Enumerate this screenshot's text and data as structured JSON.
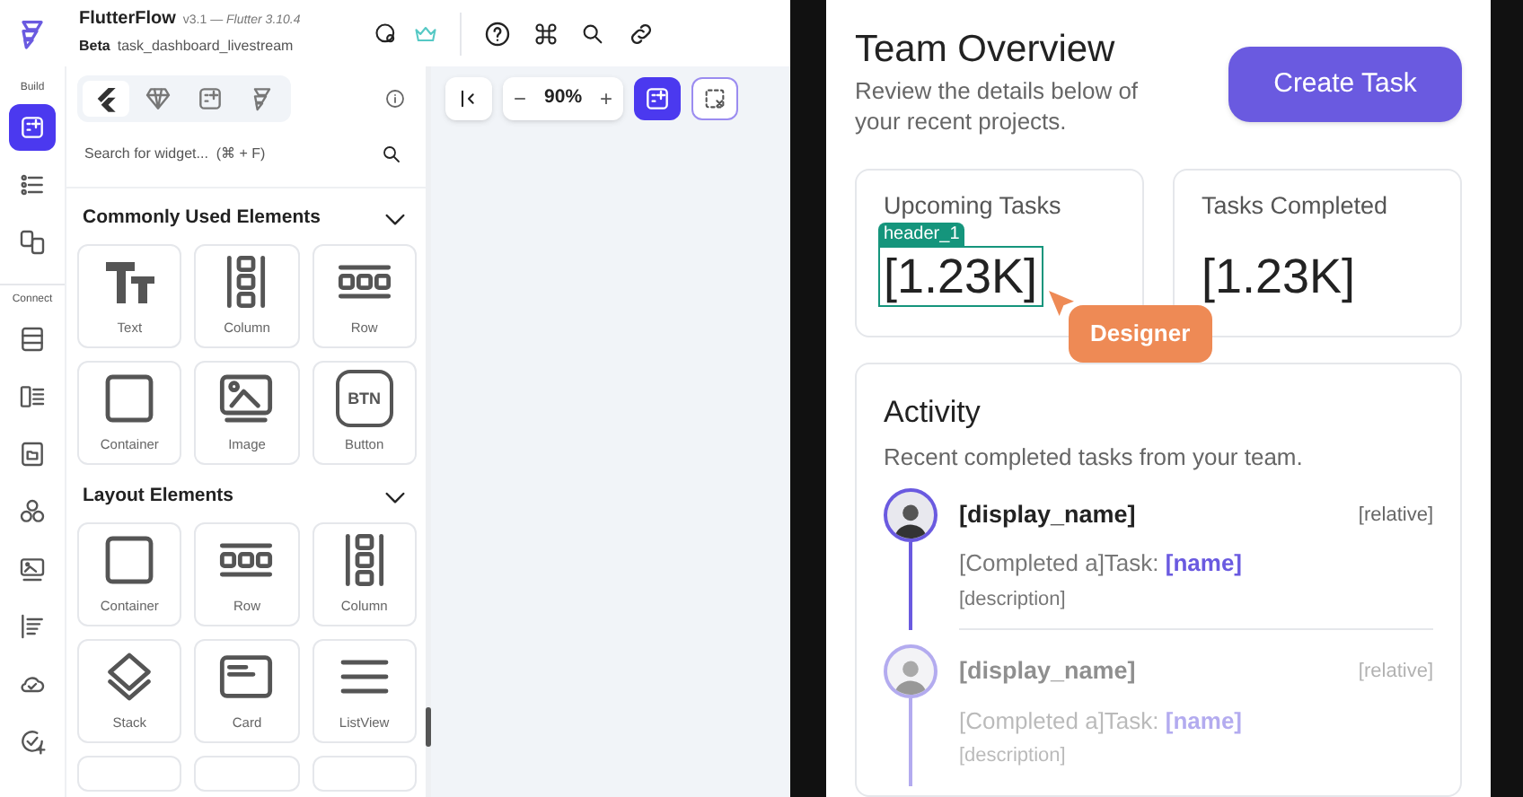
{
  "app": {
    "name": "FlutterFlow",
    "version": "v3.1 — ",
    "flutter_version": "Flutter 3.10.4",
    "channel": "Beta",
    "project": "task_dashboard_livestream"
  },
  "rail": {
    "sections": [
      {
        "label": "Build",
        "items": [
          {
            "selected": true
          },
          {
            "selected": false
          },
          {
            "selected": false
          }
        ]
      },
      {
        "label": "Connect",
        "items": [
          {
            "selected": false
          },
          {
            "selected": false
          },
          {
            "selected": false
          },
          {
            "selected": false
          },
          {
            "selected": false
          },
          {
            "selected": false
          },
          {
            "selected": false
          },
          {
            "selected": false
          }
        ]
      }
    ]
  },
  "panel": {
    "tabs": [
      {
        "selected": true
      },
      {
        "selected": false
      },
      {
        "selected": false
      },
      {
        "selected": false
      }
    ],
    "search": {
      "placeholder": "Search for widget...  (⌘ + F)"
    },
    "groups": [
      {
        "title": "Commonly Used Elements",
        "expanded": true,
        "items": [
          {
            "kind": "text",
            "label": "Text"
          },
          {
            "kind": "column",
            "label": "Column"
          },
          {
            "kind": "row",
            "label": "Row"
          },
          {
            "kind": "container",
            "label": "Container"
          },
          {
            "kind": "image",
            "label": "Image"
          },
          {
            "kind": "button",
            "label": "Button",
            "glyph": "BTN"
          }
        ]
      },
      {
        "title": "Layout Elements",
        "expanded": true,
        "items": [
          {
            "kind": "container",
            "label": "Container"
          },
          {
            "kind": "row",
            "label": "Row"
          },
          {
            "kind": "column",
            "label": "Column"
          },
          {
            "kind": "stack",
            "label": "Stack"
          },
          {
            "kind": "card",
            "label": "Card"
          },
          {
            "kind": "listview",
            "label": "ListView"
          }
        ]
      }
    ]
  },
  "canvas_toolbar": {
    "zoom": "90%",
    "minus": "−",
    "plus": "+"
  },
  "screen": {
    "title": "Team Overview",
    "subtitle": "Review the details below of your recent projects.",
    "button": "Create Task",
    "stats": [
      {
        "label": "Upcoming Tasks",
        "value": "[1.23K]",
        "selection": "header_1"
      },
      {
        "label": "Tasks Completed",
        "value": "[1.23K]"
      }
    ],
    "cursor": "Designer",
    "activity": {
      "title": "Activity",
      "subtitle": "Recent completed tasks from your team.",
      "items": [
        {
          "name": "[display_name]",
          "time": "[relative]",
          "action": "[Completed a]Task: ",
          "task": "[name]",
          "description": "[description]",
          "dimmed": false
        },
        {
          "name": "[display_name]",
          "time": "[relative]",
          "action": "[Completed a]Task: ",
          "task": "[name]",
          "description": "[description]",
          "dimmed": true
        }
      ]
    }
  }
}
